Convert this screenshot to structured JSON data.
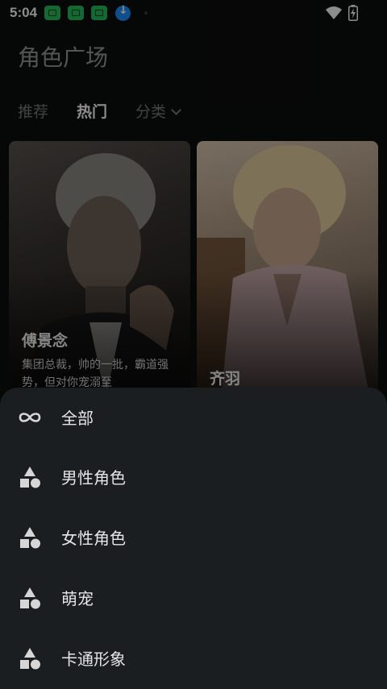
{
  "status_bar": {
    "time": "5:04",
    "icons": [
      "app-notification-icon",
      "app-notification-icon",
      "app-notification-icon",
      "download-icon",
      "wifi-icon",
      "battery-charging-icon"
    ]
  },
  "header": {
    "title": "角色广场",
    "tabs": [
      {
        "label": "推荐",
        "active": false
      },
      {
        "label": "热门",
        "active": true
      },
      {
        "label": "分类",
        "active": false
      }
    ]
  },
  "cards": [
    {
      "name": "傅景念",
      "desc": "集团总裁，帅的一批，霸道强势，但对你宠溺至"
    },
    {
      "name": "齐羽",
      "desc": ""
    }
  ],
  "sheet": {
    "items": [
      {
        "label": "全部",
        "icon": "infinity-icon"
      },
      {
        "label": "男性角色",
        "icon": "shapes-icon"
      },
      {
        "label": "女性角色",
        "icon": "shapes-icon"
      },
      {
        "label": "萌宠",
        "icon": "shapes-icon"
      },
      {
        "label": "卡通形象",
        "icon": "shapes-icon"
      }
    ]
  },
  "colors": {
    "background": "#0c0d0e",
    "sheet": "#1b1e21",
    "notification_green": "#21c25b",
    "download_blue": "#1f8fff"
  }
}
